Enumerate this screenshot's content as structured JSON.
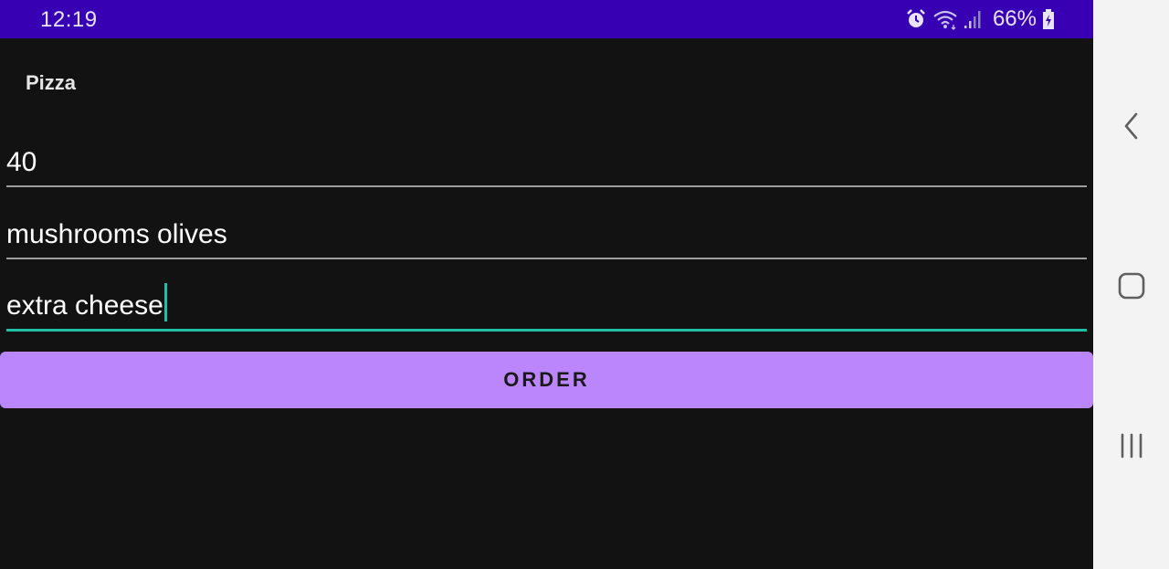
{
  "status_bar": {
    "time": "12:19",
    "battery": "66%",
    "icons": [
      "alarm-icon",
      "wifi-icon",
      "signal-icon",
      "battery-charging-icon"
    ],
    "background": "#3700b3"
  },
  "app": {
    "title": "Pizza"
  },
  "form": {
    "size_value": "40",
    "toppings_value": "mushrooms olives",
    "extras_value": "extra cheese",
    "focused_field": "extras",
    "accent_color": "#1fbfa6"
  },
  "order_button": {
    "label": "ORDER",
    "color": "#bb86fc"
  },
  "nav_bar": {
    "icons": [
      "back-icon",
      "home-icon",
      "recents-icon"
    ]
  }
}
